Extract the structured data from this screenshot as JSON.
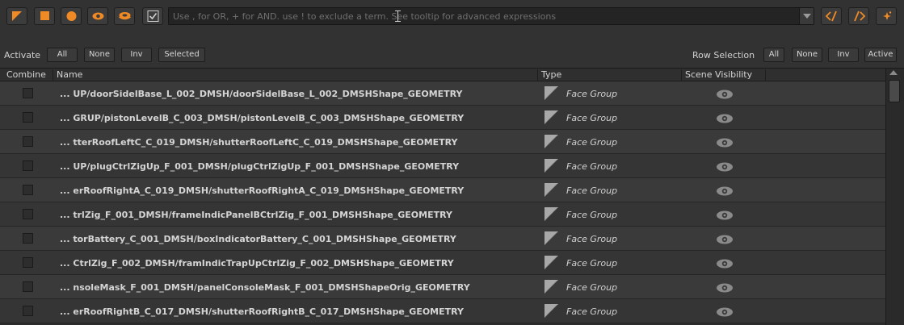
{
  "toolbar": {
    "icons": [
      "triangle-filter-icon",
      "square-filter-icon",
      "circle-filter-icon",
      "eye-filter-icon",
      "layers-filter-icon",
      "checkbox-filter-icon",
      "expand-left-icon",
      "expand-right-icon",
      "sparkle-icon"
    ],
    "accent_color": "#f08a24"
  },
  "search": {
    "placeholder": "Use , for OR, + for AND. use ! to exclude a term. See tooltip for advanced expressions"
  },
  "activate": {
    "label": "Activate",
    "buttons": [
      "All",
      "None",
      "Inv",
      "Selected"
    ]
  },
  "row_selection": {
    "label": "Row Selection",
    "buttons": [
      "All",
      "None",
      "Inv",
      "Active"
    ]
  },
  "table": {
    "headers": [
      "Combine",
      "Name",
      "Type",
      "Scene Visibility"
    ],
    "rows": [
      {
        "name": "... UP/doorSidelBase_L_002_DMSH/doorSidelBase_L_002_DMSHShape_GEOMETRY",
        "type": "Face Group"
      },
      {
        "name": "... GRUP/pistonLevelB_C_003_DMSH/pistonLevelB_C_003_DMSHShape_GEOMETRY",
        "type": "Face Group"
      },
      {
        "name": "... tterRoofLeftC_C_019_DMSH/shutterRoofLeftC_C_019_DMSHShape_GEOMETRY",
        "type": "Face Group"
      },
      {
        "name": "... UP/plugCtrlZigUp_F_001_DMSH/plugCtrlZigUp_F_001_DMSHShape_GEOMETRY",
        "type": "Face Group"
      },
      {
        "name": "... erRoofRightA_C_019_DMSH/shutterRoofRightA_C_019_DMSHShape_GEOMETRY",
        "type": "Face Group"
      },
      {
        "name": "... trlZig_F_001_DMSH/frameIndicPanelBCtrlZig_F_001_DMSHShape_GEOMETRY",
        "type": "Face Group"
      },
      {
        "name": "... torBattery_C_001_DMSH/boxIndicatorBattery_C_001_DMSHShape_GEOMETRY",
        "type": "Face Group"
      },
      {
        "name": "... CtrlZig_F_002_DMSH/framIndicTrapUpCtrlZig_F_002_DMSHShape_GEOMETRY",
        "type": "Face Group"
      },
      {
        "name": "... nsoleMask_F_001_DMSH/panelConsoleMask_F_001_DMSHShapeOrig_GEOMETRY",
        "type": "Face Group"
      },
      {
        "name": "... erRoofRightB_C_017_DMSH/shutterRoofRightB_C_017_DMSHShape_GEOMETRY",
        "type": "Face Group"
      }
    ]
  }
}
